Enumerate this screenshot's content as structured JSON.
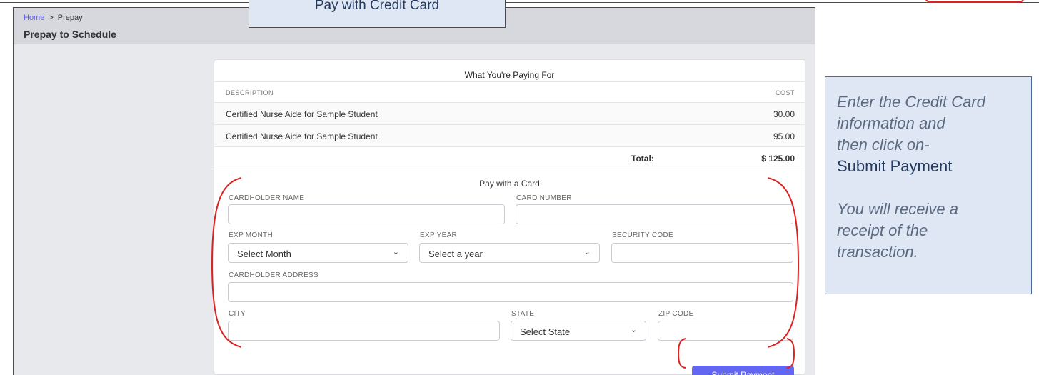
{
  "callout_top": {
    "text": "Pay with Credit Card"
  },
  "breadcrumb": {
    "home": "Home",
    "separator": ">",
    "current": "Prepay"
  },
  "page": {
    "title": "Prepay to Schedule"
  },
  "summary": {
    "title": "What You're Paying For",
    "columns": {
      "description": "DESCRIPTION",
      "cost": "COST"
    },
    "rows": [
      {
        "description": "Certified Nurse Aide for Sample Student",
        "cost": "30.00"
      },
      {
        "description": "Certified Nurse Aide for Sample Student",
        "cost": "95.00"
      }
    ],
    "total_label": "Total:",
    "total_value": "$ 125.00"
  },
  "form": {
    "title": "Pay with a Card",
    "cardholder_name_label": "CARDHOLDER NAME",
    "card_number_label": "CARD NUMBER",
    "exp_month_label": "EXP MONTH",
    "exp_month_value": "Select Month",
    "exp_year_label": "EXP YEAR",
    "exp_year_value": "Select a year",
    "security_code_label": "SECURITY CODE",
    "address_label": "CARDHOLDER ADDRESS",
    "city_label": "CITY",
    "state_label": "STATE",
    "state_value": "Select State",
    "zip_label": "ZIP CODE",
    "submit_label": "Submit Payment"
  },
  "callout_side": {
    "line1": "Enter the Credit Card",
    "line2": "information and",
    "line3": "then click on-",
    "line4": "Submit Payment",
    "line5": "You will receive a",
    "line6": "receipt of the",
    "line7": "transaction."
  },
  "colors": {
    "accent": "#6366f1",
    "annotation_red": "#dd2222",
    "callout_bg": "#dfe7f5"
  }
}
